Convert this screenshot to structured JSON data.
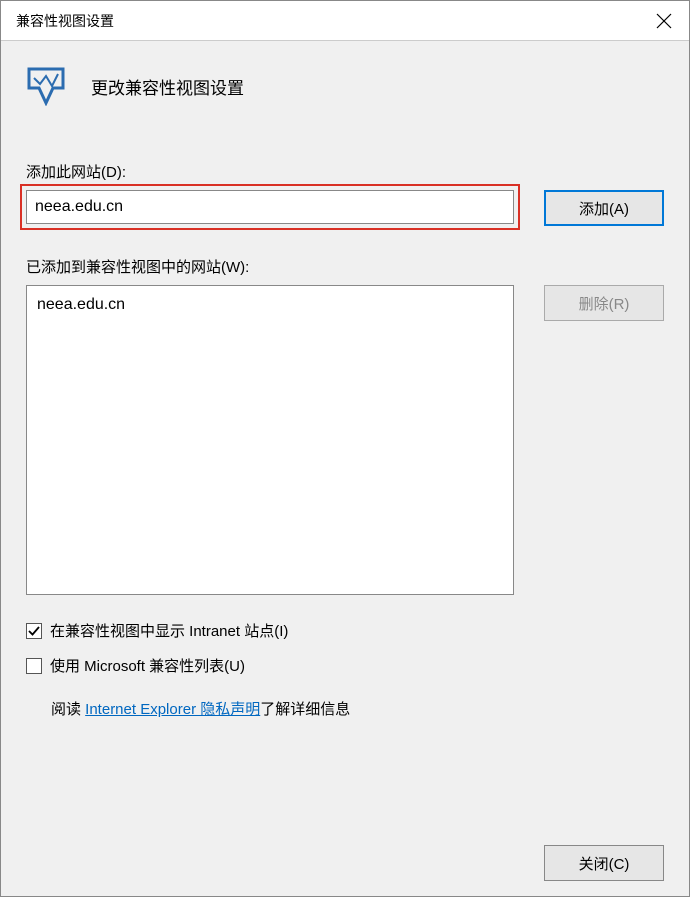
{
  "titlebar": {
    "title": "兼容性视图设置"
  },
  "header": {
    "text": "更改兼容性视图设置"
  },
  "addSite": {
    "label": "添加此网站(D):",
    "value": "neea.edu.cn",
    "buttonLabel": "添加(A)"
  },
  "siteList": {
    "label": "已添加到兼容性视图中的网站(W):",
    "items": [
      "neea.edu.cn"
    ],
    "removeButtonLabel": "删除(R)"
  },
  "options": {
    "intranetCheckbox": {
      "label": "在兼容性视图中显示 Intranet 站点(I)",
      "checked": true
    },
    "microsoftListCheckbox": {
      "label": "使用 Microsoft 兼容性列表(U)",
      "checked": false
    },
    "privacy": {
      "prefix": "阅读 ",
      "linkText": "Internet Explorer 隐私声明",
      "suffix": "了解详细信息"
    }
  },
  "footer": {
    "closeButtonLabel": "关闭(C)"
  }
}
